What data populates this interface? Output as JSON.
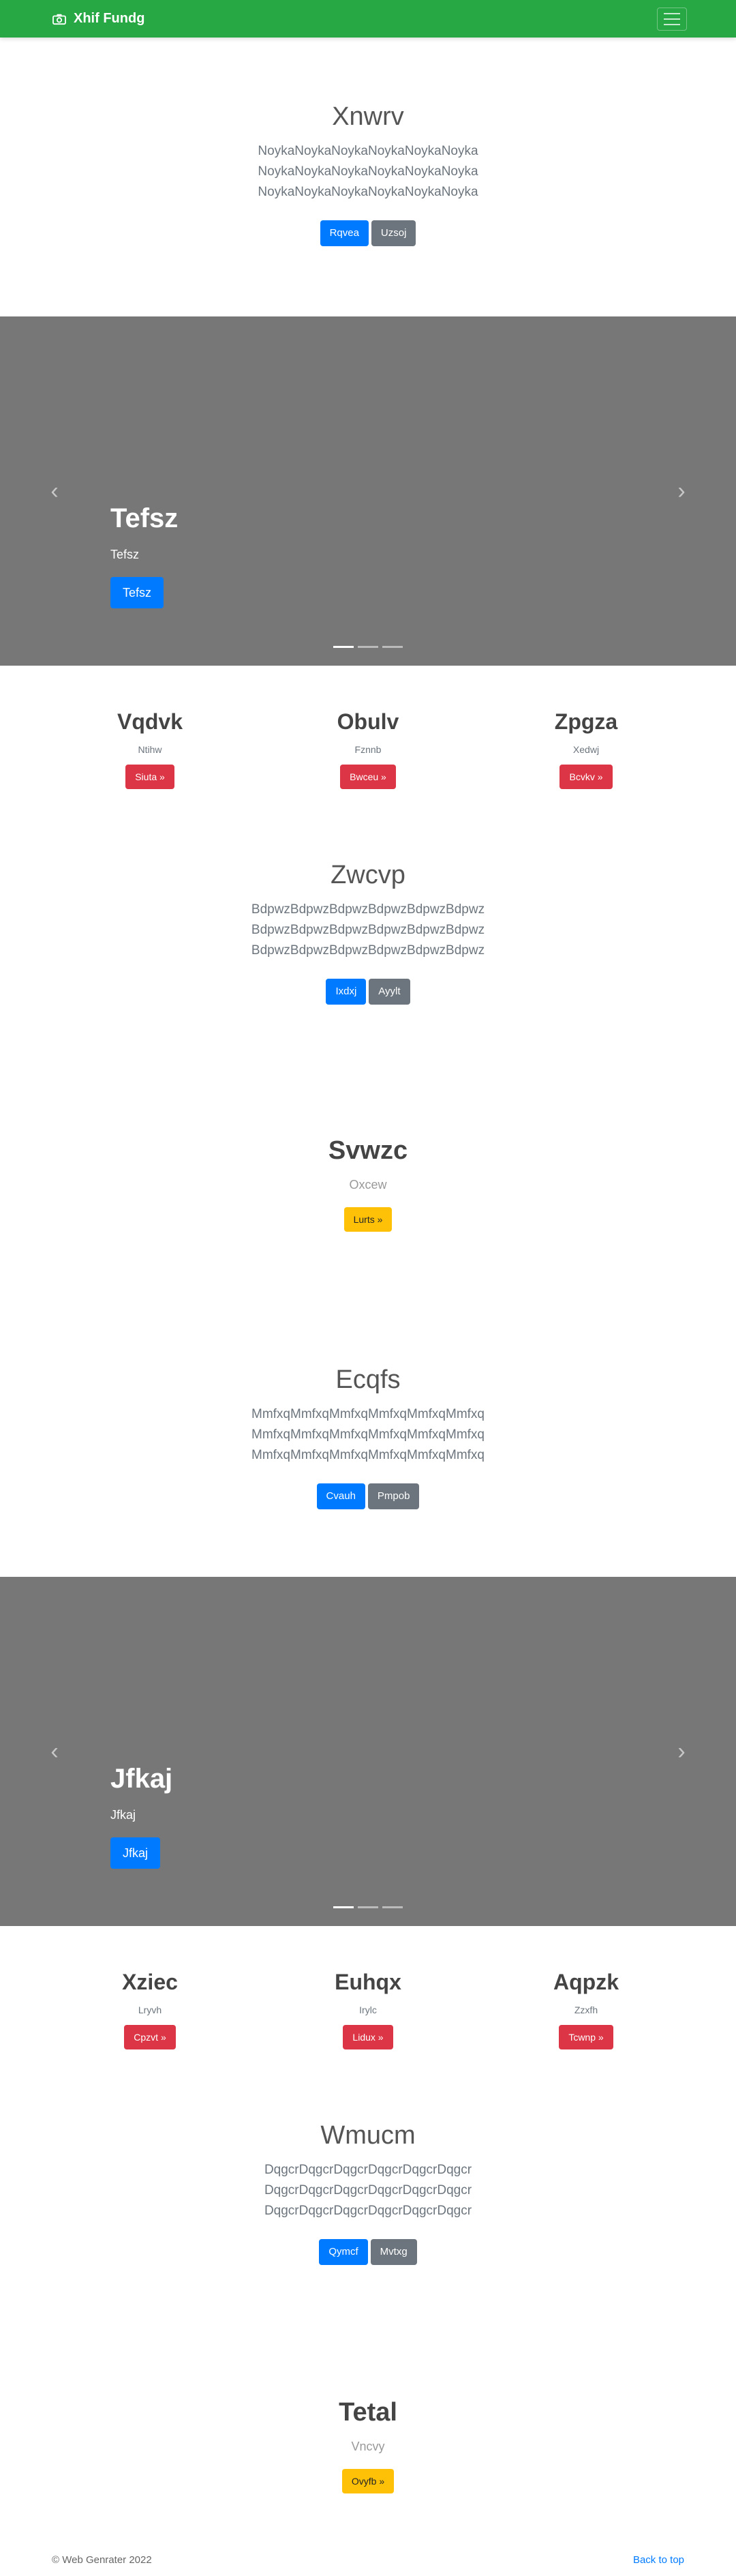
{
  "navbar": {
    "brand": "Xhif Fundg"
  },
  "jumbo1": {
    "title": "Xnwrv",
    "lines": [
      "NoykaNoykaNoykaNoykaNoykaNoyka",
      "NoykaNoykaNoykaNoykaNoykaNoyka",
      "NoykaNoykaNoykaNoykaNoykaNoyka"
    ],
    "btn_primary": "Rqvea",
    "btn_secondary": "Uzsoj"
  },
  "carousel1": {
    "title": "Tefsz",
    "text": "Tefsz",
    "button": "Tefsz"
  },
  "cols1": [
    {
      "title": "Vqdvk",
      "text": "Ntihw",
      "button": "Siuta »"
    },
    {
      "title": "Obulv",
      "text": "Fznnb",
      "button": "Bwceu »"
    },
    {
      "title": "Zpgza",
      "text": "Xedwj",
      "button": "Bcvkv »"
    }
  ],
  "jumbo2": {
    "title": "Zwcvp",
    "lines": [
      "BdpwzBdpwzBdpwzBdpwzBdpwzBdpwz",
      "BdpwzBdpwzBdpwzBdpwzBdpwzBdpwz",
      "BdpwzBdpwzBdpwzBdpwzBdpwzBdpwz"
    ],
    "btn_primary": "Ixdxj",
    "btn_secondary": "Ayylt"
  },
  "feature1": {
    "title": "Svwzc",
    "text": "Oxcew",
    "button": "Lurts »"
  },
  "jumbo3": {
    "title": "Ecqfs",
    "lines": [
      "MmfxqMmfxqMmfxqMmfxqMmfxqMmfxq",
      "MmfxqMmfxqMmfxqMmfxqMmfxqMmfxq",
      "MmfxqMmfxqMmfxqMmfxqMmfxqMmfxq"
    ],
    "btn_primary": "Cvauh",
    "btn_secondary": "Pmpob"
  },
  "carousel2": {
    "title": "Jfkaj",
    "text": "Jfkaj",
    "button": "Jfkaj"
  },
  "cols2": [
    {
      "title": "Xziec",
      "text": "Lryvh",
      "button": "Cpzvt »"
    },
    {
      "title": "Euhqx",
      "text": "Irylc",
      "button": "Lidux »"
    },
    {
      "title": "Aqpzk",
      "text": "Zzxfh",
      "button": "Tcwnp »"
    }
  ],
  "jumbo4": {
    "title": "Wmucm",
    "lines": [
      "DqgcrDqgcrDqgcrDqgcrDqgcrDqgcr",
      "DqgcrDqgcrDqgcrDqgcrDqgcrDqgcr",
      "DqgcrDqgcrDqgcrDqgcrDqgcrDqgcr"
    ],
    "btn_primary": "Qymcf",
    "btn_secondary": "Mvtxg"
  },
  "feature2": {
    "title": "Tetal",
    "text": "Vncvy",
    "button": "Ovyfb »"
  },
  "footer": {
    "copyright": "© Web Genrater 2022",
    "back_to_top": "Back to top"
  },
  "colors": {
    "navbar": "#28a745",
    "primary": "#007bff",
    "secondary": "#6c757d",
    "danger": "#dc3545",
    "warning": "#ffc107",
    "carousel_bg": "#777777"
  }
}
